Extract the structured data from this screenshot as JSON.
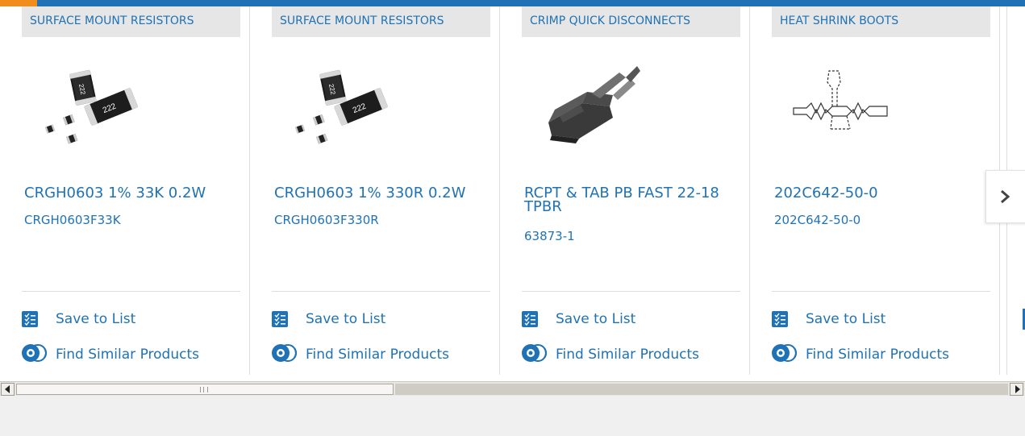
{
  "theme": {
    "accent": "#1f72b5",
    "highlight": "#f28c1c",
    "category_bg": "#e6e6e6"
  },
  "carousel": {
    "cards": [
      {
        "category": "SURFACE MOUNT RESISTORS",
        "image": "chip-resistors-image",
        "name": "CRGH0603 1% 33K 0.2W",
        "part_number": "CRGH0603F33K",
        "save_label": "Save to List",
        "find_label": "Find Similar Products"
      },
      {
        "category": "SURFACE MOUNT RESISTORS",
        "image": "chip-resistors-image",
        "name": "CRGH0603 1% 330R 0.2W",
        "part_number": "CRGH0603F330R",
        "save_label": "Save to List",
        "find_label": "Find Similar Products"
      },
      {
        "category": "CRIMP QUICK DISCONNECTS",
        "image": "crimp-terminal-image",
        "name": "RCPT & TAB PB FAST 22-18 TPBR",
        "part_number": "63873-1",
        "save_label": "Save to List",
        "find_label": "Find Similar Products"
      },
      {
        "category": "HEAT SHRINK BOOTS",
        "image": "boot-drawing-image",
        "name": "202C642-50-0",
        "part_number": "202C642-50-0",
        "save_label": "Save to List",
        "find_label": "Find Similar Products"
      }
    ],
    "next_icon": "chevron-right-icon"
  },
  "scrollbar": {
    "left_icon": "arrow-left-icon",
    "right_icon": "arrow-right-icon"
  }
}
